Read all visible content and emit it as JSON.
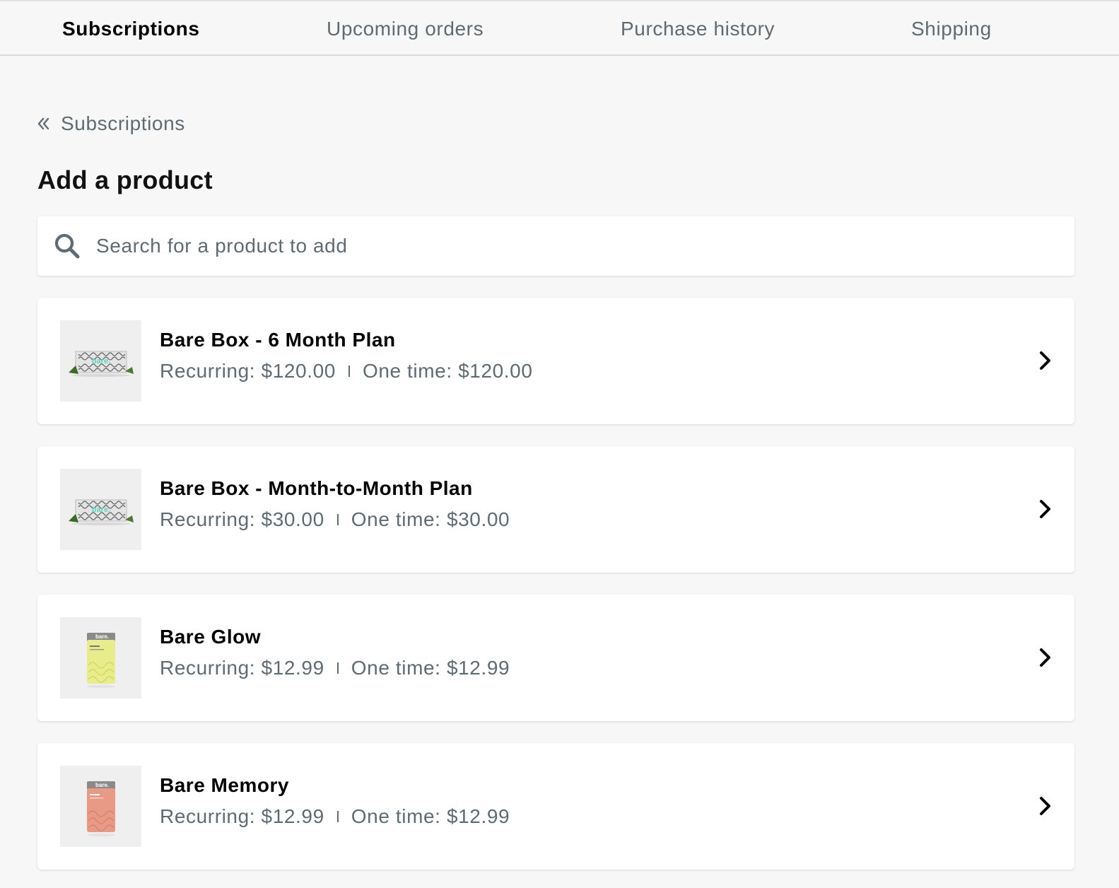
{
  "tabs": [
    {
      "label": "Subscriptions",
      "active": true
    },
    {
      "label": "Upcoming orders",
      "active": false
    },
    {
      "label": "Purchase history",
      "active": false
    },
    {
      "label": "Shipping",
      "active": false
    }
  ],
  "breadcrumb": {
    "label": "Subscriptions",
    "icon": "double-chevron-left-icon"
  },
  "page_title": "Add a product",
  "search": {
    "placeholder": "Search for a product to add",
    "value": "",
    "icon": "search-icon"
  },
  "separator": "|",
  "products": [
    {
      "name": "Bare Box - 6 Month Plan",
      "recurring": "Recurring: $120.00",
      "one_time": "One time: $120.00",
      "image": "bare-box-image",
      "image_text": "bare."
    },
    {
      "name": "Bare Box - Month-to-Month Plan",
      "recurring": "Recurring: $30.00",
      "one_time": "One time: $30.00",
      "image": "bare-box-image",
      "image_text": "bare."
    },
    {
      "name": "Bare Glow",
      "recurring": "Recurring: $12.99",
      "one_time": "One time: $12.99",
      "image": "bare-glow-tin-image",
      "image_text": "bare."
    },
    {
      "name": "Bare Memory",
      "recurring": "Recurring: $12.99",
      "one_time": "One time: $12.99",
      "image": "bare-memory-tin-image",
      "image_text": "bare."
    }
  ],
  "colors": {
    "background": "#f7f7f7",
    "muted_text": "#5f6b72",
    "box_accent": "#5fd3c3",
    "glow_tin": "#e8ec8a",
    "memory_tin": "#e89a86"
  }
}
